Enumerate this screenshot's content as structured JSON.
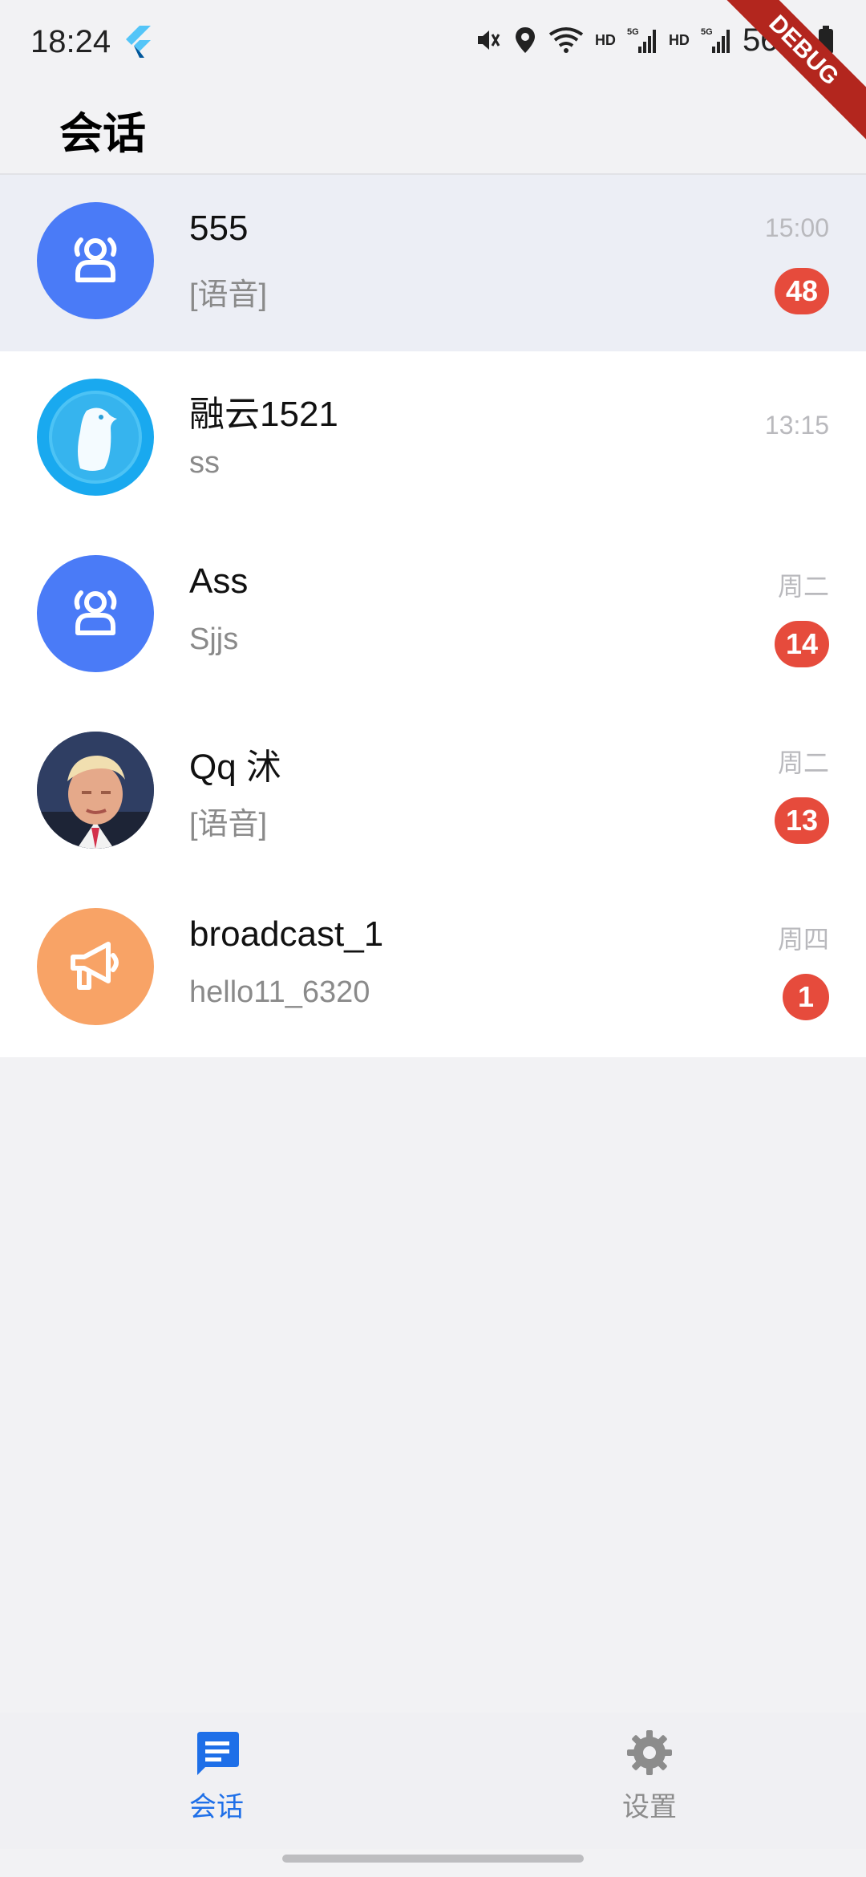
{
  "status_bar": {
    "time": "18:24",
    "battery": "56%",
    "network_hd": "HD",
    "network_5g": "5G"
  },
  "debug_ribbon": "DEBUG",
  "header": {
    "title": "会话"
  },
  "conversations": [
    {
      "name": "555",
      "preview": "[语音]",
      "time": "15:00",
      "unread": "48",
      "avatar": "group-icon",
      "avatar_color": "#4a7bf7"
    },
    {
      "name": "融云1521",
      "preview": "ss",
      "time": "13:15",
      "unread": "",
      "avatar": "penguin-icon",
      "avatar_color": "#19a9ef"
    },
    {
      "name": "Ass",
      "preview": "Sjjs",
      "time": "周二",
      "unread": "14",
      "avatar": "group-icon",
      "avatar_color": "#4a7bf7"
    },
    {
      "name": "Qq 沭",
      "preview": "[语音]",
      "time": "周二",
      "unread": "13",
      "avatar": "user-photo",
      "avatar_color": "#c9a48a"
    },
    {
      "name": "broadcast_1",
      "preview": "hello11_6320",
      "time": "周四",
      "unread": "1",
      "avatar": "megaphone-icon",
      "avatar_color": "#f8a366"
    }
  ],
  "bottom_nav": [
    {
      "label": "会话",
      "icon": "chat-icon",
      "active": true,
      "color": "#1e6fe8"
    },
    {
      "label": "设置",
      "icon": "gear-icon",
      "active": false,
      "color": "#8c8c8c"
    }
  ]
}
